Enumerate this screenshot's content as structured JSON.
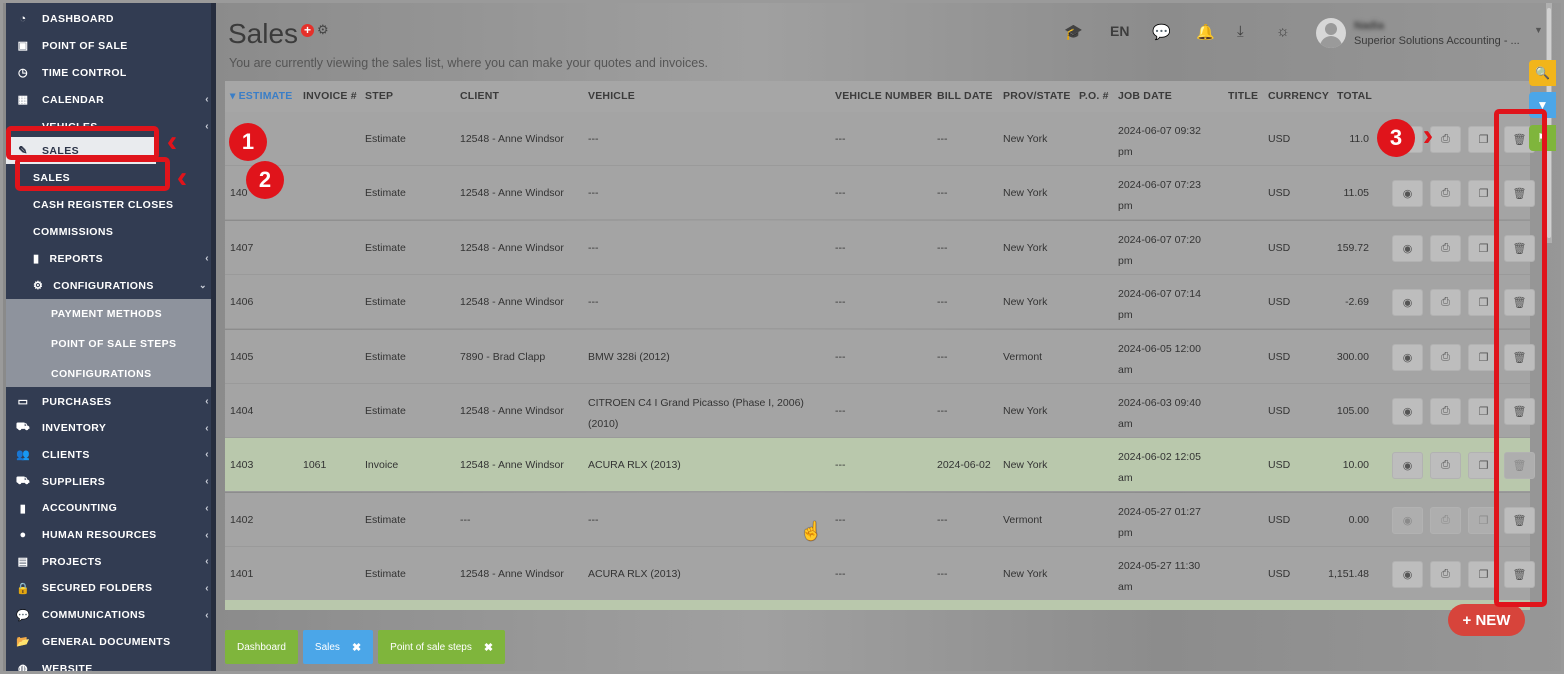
{
  "sidebar": {
    "items": [
      {
        "label": "DASHBOARD",
        "icon": "dashboard-icon",
        "glyph": "◔",
        "chev": false
      },
      {
        "label": "POINT OF SALE",
        "icon": "cash-icon",
        "glyph": "▣",
        "chev": false
      },
      {
        "label": "TIME CONTROL",
        "icon": "clock-icon",
        "glyph": "◷",
        "chev": false
      },
      {
        "label": "CALENDAR",
        "icon": "calendar-icon",
        "glyph": "▦",
        "chev": true
      },
      {
        "label": "VEHICLES",
        "icon": "car-icon",
        "glyph": "▬",
        "chev": true
      },
      {
        "label": "SALES",
        "icon": "edit-icon",
        "glyph": "✎",
        "chev": true
      }
    ],
    "sales_sub": [
      "SALES",
      "CASH REGISTER CLOSES",
      "COMMISSIONS"
    ],
    "reports": "REPORTS",
    "configurations": "CONFIGURATIONS",
    "config_sub": [
      "PAYMENT METHODS",
      "POINT OF SALE STEPS",
      "CONFIGURATIONS"
    ],
    "lower_items": [
      {
        "label": "PURCHASES",
        "icon": "card-icon",
        "glyph": "▭"
      },
      {
        "label": "INVENTORY",
        "icon": "cart-icon",
        "glyph": "⛟"
      },
      {
        "label": "CLIENTS",
        "icon": "users-icon",
        "glyph": "👥"
      },
      {
        "label": "SUPPLIERS",
        "icon": "truck-icon",
        "glyph": "⛟"
      },
      {
        "label": "ACCOUNTING",
        "icon": "bar-chart-icon",
        "glyph": "▮"
      },
      {
        "label": "HUMAN RESOURCES",
        "icon": "user-icon",
        "glyph": "●"
      },
      {
        "label": "PROJECTS",
        "icon": "list-icon",
        "glyph": "▤"
      },
      {
        "label": "SECURED FOLDERS",
        "icon": "lock-icon",
        "glyph": "🔒"
      },
      {
        "label": "COMMUNICATIONS",
        "icon": "chat-icon",
        "glyph": "💬"
      },
      {
        "label": "GENERAL DOCUMENTS",
        "icon": "folder-icon",
        "glyph": "📂"
      },
      {
        "label": "WEBSITE",
        "icon": "globe-icon",
        "glyph": "◍"
      }
    ]
  },
  "header": {
    "title": "Sales",
    "subtitle": "You are currently viewing the sales list, where you can make your quotes and invoices.",
    "lang": "EN",
    "user_name": "Nadia",
    "user_company": "Superior Solutions Accounting - ..."
  },
  "table": {
    "columns": [
      "ESTIMATE",
      "INVOICE #",
      "STEP",
      "CLIENT",
      "VEHICLE",
      "VEHICLE NUMBER",
      "BILL DATE",
      "PROV/STATE",
      "P.O. #",
      "JOB DATE",
      "TITLE",
      "CURRENCY",
      "TOTAL"
    ],
    "rows": [
      {
        "estimate": "",
        "invoice": "",
        "step": "Estimate",
        "client": "12548 - Anne Windsor",
        "vehicle": "---",
        "vnum": "---",
        "bill": "---",
        "state": "New York",
        "po": "",
        "job1": "2024-06-07 09:32",
        "job2": "pm",
        "title": "",
        "currency": "USD",
        "total": "11.0",
        "green": false,
        "dim": false
      },
      {
        "estimate": "140",
        "invoice": "",
        "step": "Estimate",
        "client": "12548 - Anne Windsor",
        "vehicle": "---",
        "vnum": "---",
        "bill": "---",
        "state": "New York",
        "po": "",
        "job1": "2024-06-07 07:23",
        "job2": "pm",
        "title": "",
        "currency": "USD",
        "total": "11.05",
        "green": false,
        "dim": false
      },
      {
        "estimate": "1407",
        "invoice": "",
        "step": "Estimate",
        "client": "12548 - Anne Windsor",
        "vehicle": "---",
        "vnum": "---",
        "bill": "---",
        "state": "New York",
        "po": "",
        "job1": "2024-06-07 07:20",
        "job2": "pm",
        "title": "",
        "currency": "USD",
        "total": "159.72",
        "green": false,
        "dim": false
      },
      {
        "estimate": "1406",
        "invoice": "",
        "step": "Estimate",
        "client": "12548 - Anne Windsor",
        "vehicle": "---",
        "vnum": "---",
        "bill": "---",
        "state": "New York",
        "po": "",
        "job1": "2024-06-07 07:14",
        "job2": "pm",
        "title": "",
        "currency": "USD",
        "total": "-2.69",
        "green": false,
        "dim": false
      },
      {
        "estimate": "1405",
        "invoice": "",
        "step": "Estimate",
        "client": "7890 - Brad Clapp",
        "vehicle": "BMW 328i (2012)",
        "vehicle2": "",
        "vnum": "---",
        "bill": "---",
        "state": "Vermont",
        "po": "",
        "job1": "2024-06-05 12:00",
        "job2": "am",
        "title": "",
        "currency": "USD",
        "total": "300.00",
        "green": false,
        "dim": false
      },
      {
        "estimate": "1404",
        "invoice": "",
        "step": "Estimate",
        "client": "12548 - Anne Windsor",
        "vehicle": "CITROEN C4 I Grand Picasso (Phase I, 2006)",
        "vehicle2": "(2010)",
        "vnum": "---",
        "bill": "---",
        "state": "New York",
        "po": "",
        "job1": "2024-06-03 09:40",
        "job2": "am",
        "title": "",
        "currency": "USD",
        "total": "105.00",
        "green": false,
        "dim": false
      },
      {
        "estimate": "1403",
        "invoice": "1061",
        "step": "Invoice",
        "client": "12548 - Anne Windsor",
        "vehicle": "ACURA RLX (2013)",
        "vnum": "---",
        "bill": "2024-06-02",
        "state": "New York",
        "po": "",
        "job1": "2024-06-02 12:05",
        "job2": "am",
        "title": "",
        "currency": "USD",
        "total": "10.00",
        "green": true,
        "dim": false
      },
      {
        "estimate": "1402",
        "invoice": "",
        "step": "Estimate",
        "client": "---",
        "vehicle": "---",
        "vnum": "---",
        "bill": "---",
        "state": "Vermont",
        "po": "",
        "job1": "2024-05-27 01:27",
        "job2": "pm",
        "title": "",
        "currency": "USD",
        "total": "0.00",
        "green": false,
        "dim": true
      },
      {
        "estimate": "1401",
        "invoice": "",
        "step": "Estimate",
        "client": "12548 - Anne Windsor",
        "vehicle": "ACURA RLX (2013)",
        "vnum": "---",
        "bill": "---",
        "state": "New York",
        "po": "",
        "job1": "2024-05-27 11:30",
        "job2": "am",
        "title": "",
        "currency": "USD",
        "total": "1,151.48",
        "green": false,
        "dim": false
      }
    ]
  },
  "bottom_tabs": [
    {
      "label": "Dashboard",
      "color": "#7fb53c",
      "closable": false
    },
    {
      "label": "Sales",
      "color": "#4ba6e8",
      "closable": true
    },
    {
      "label": "Point of sale steps",
      "color": "#7fb53c",
      "closable": true
    }
  ],
  "new_button": "+ NEW",
  "annotations": [
    "1",
    "2",
    "3"
  ],
  "colors": {
    "accent_blue": "#3a7ec7",
    "annotation_red": "#e0141b",
    "green_tab": "#7fb53c",
    "blue_tab": "#4ba6e8"
  }
}
